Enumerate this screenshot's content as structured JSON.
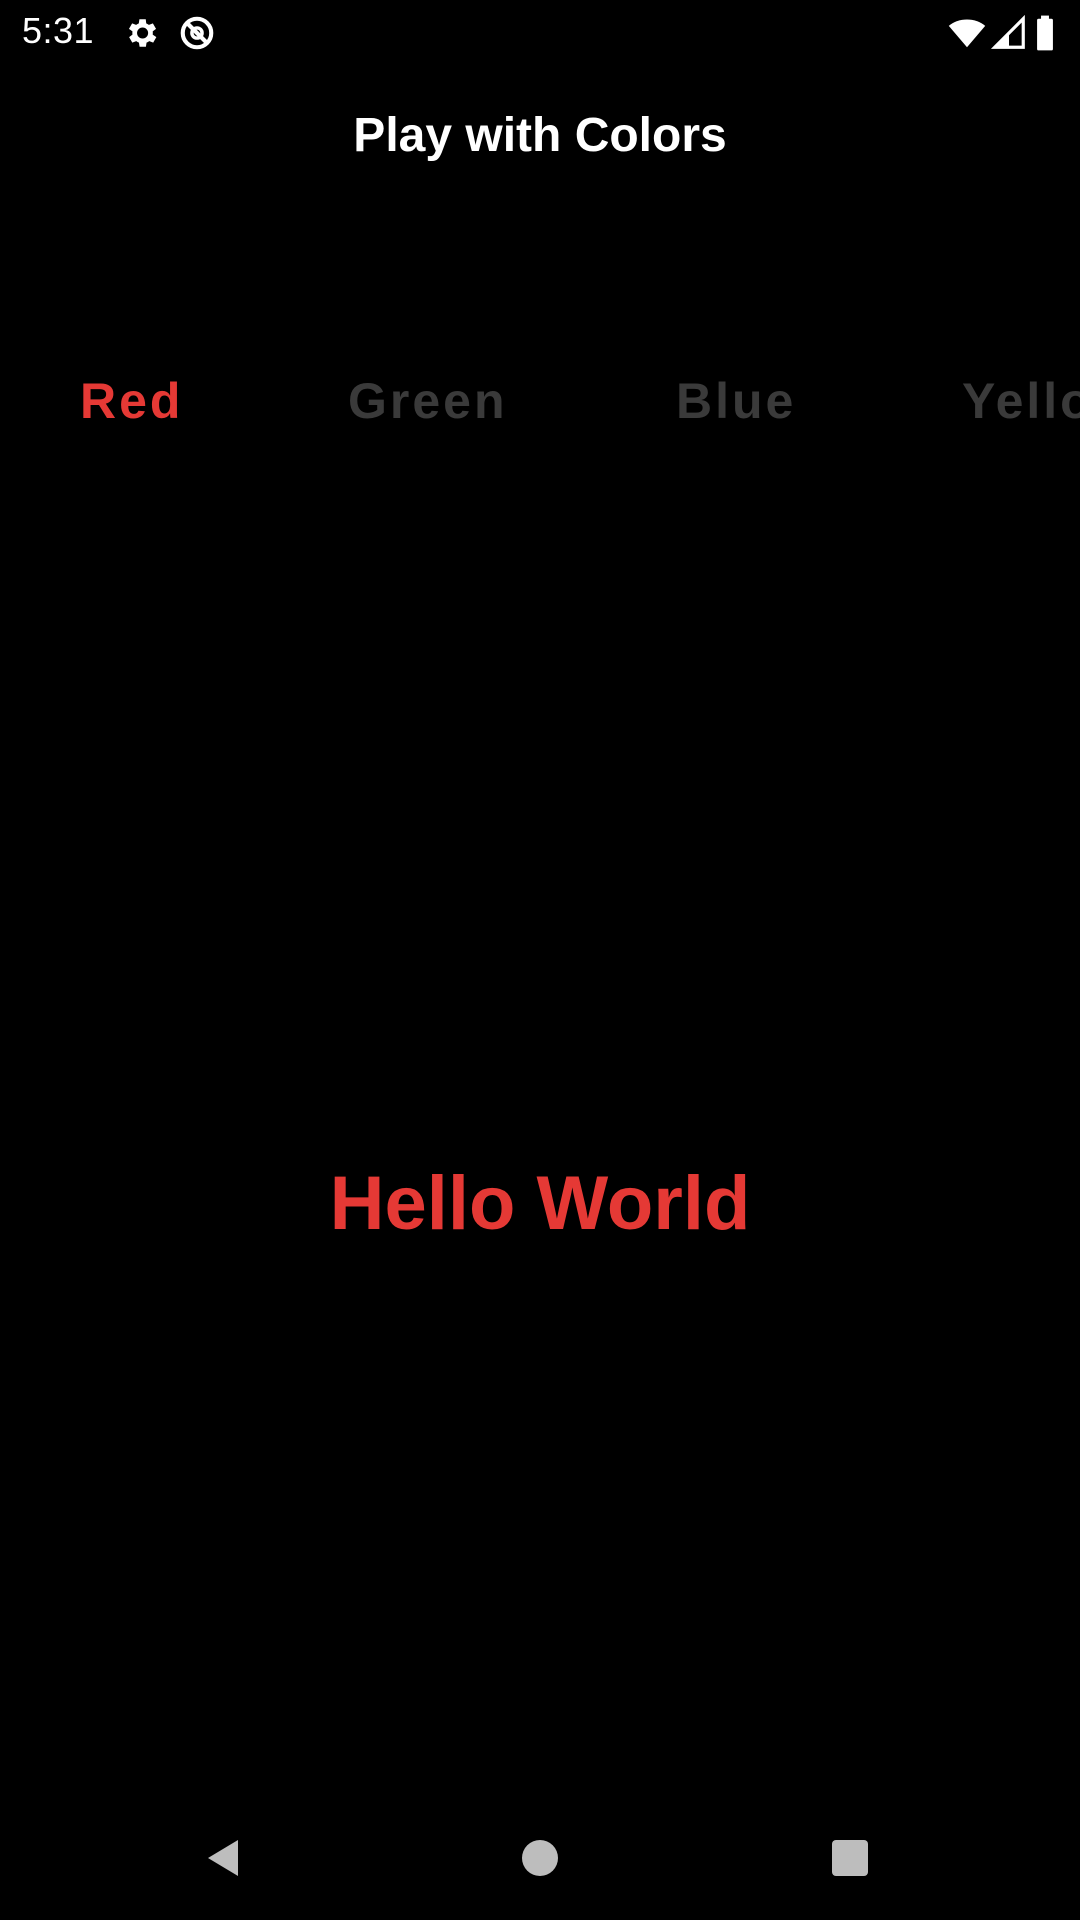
{
  "status_bar": {
    "time": "5:31",
    "icons": [
      "settings-gear-icon",
      "data-saver-icon",
      "wifi-icon",
      "signal-icon",
      "battery-icon"
    ]
  },
  "app": {
    "title": "Play with Colors"
  },
  "tabs": [
    {
      "label": "Red",
      "color": "#e53935",
      "selected": true
    },
    {
      "label": "Green",
      "color": "#3a3a3a",
      "selected": false
    },
    {
      "label": "Blue",
      "color": "#3a3a3a",
      "selected": false
    },
    {
      "label": "Yello",
      "color": "#3a3a3a",
      "selected": false
    }
  ],
  "main": {
    "hello_text": "Hello World",
    "hello_color": "#e53935"
  },
  "nav_bar": {
    "buttons": [
      "back-icon",
      "home-icon",
      "recents-icon"
    ],
    "color": "#bdbdbd"
  },
  "colors": {
    "background": "#000000",
    "accent": "#e53935",
    "inactive_tab": "#3a3a3a",
    "text": "#ffffff"
  }
}
